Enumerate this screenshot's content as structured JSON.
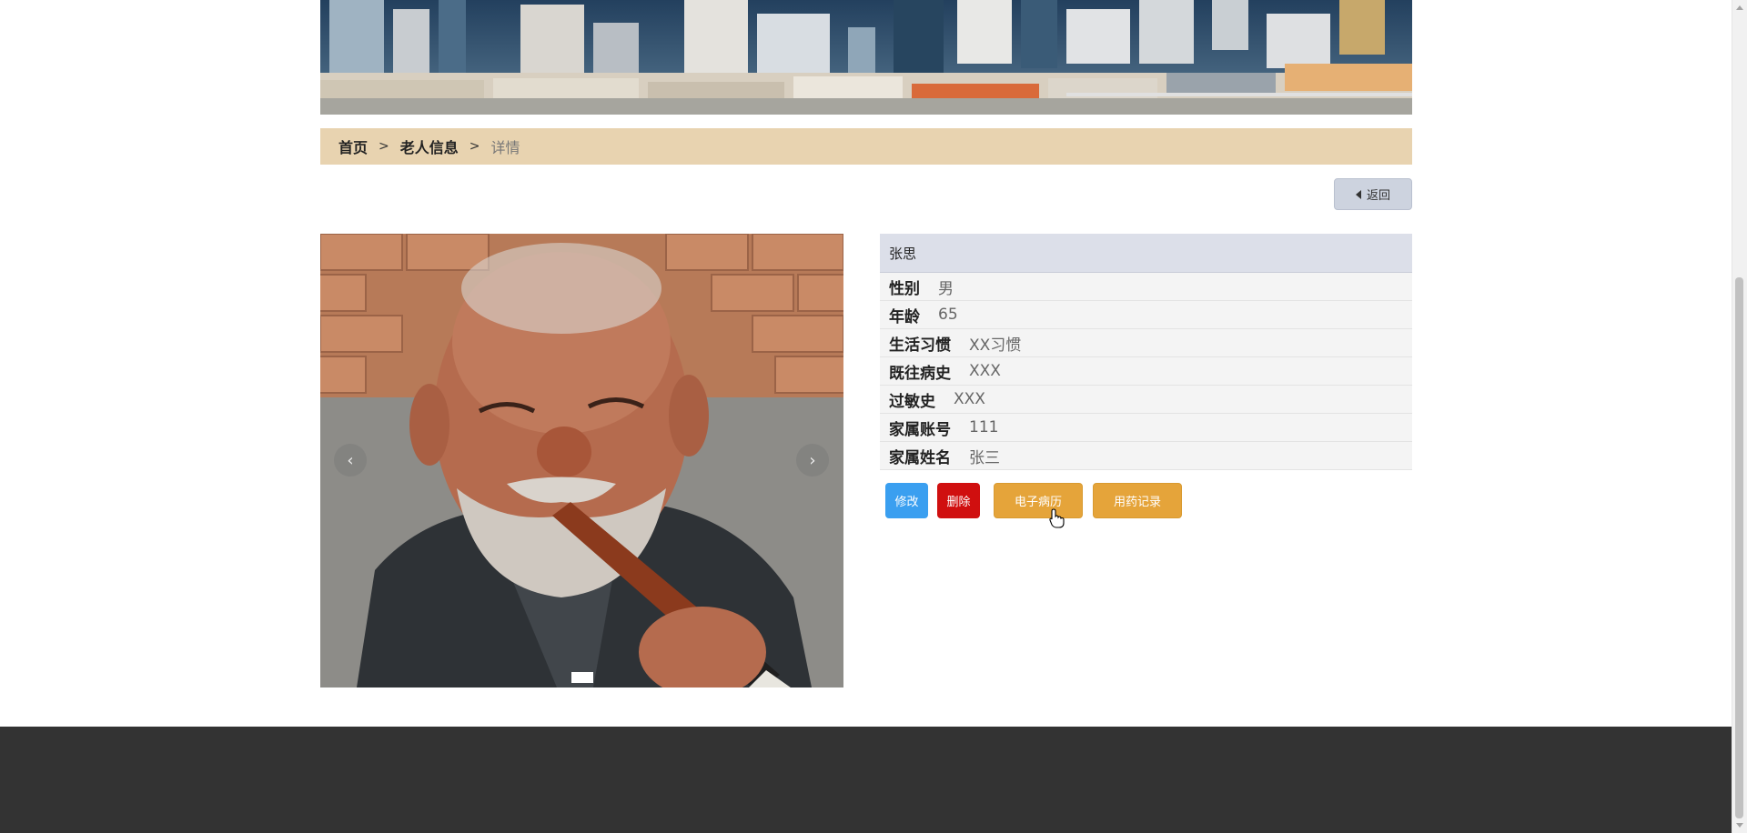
{
  "breadcrumb": {
    "home": "首页",
    "sep1": ">",
    "section": "老人信息",
    "sep2": ">",
    "current": "详情"
  },
  "back_button": {
    "label": "返回",
    "icon": "caret-left-icon"
  },
  "carousel": {
    "prev_icon": "‹",
    "next_icon": "›",
    "slide_count": 1,
    "active_slide": 1
  },
  "profile": {
    "name": "张思",
    "fields": [
      {
        "label": "性别",
        "value": "男"
      },
      {
        "label": "年龄",
        "value": "65"
      },
      {
        "label": "生活习惯",
        "value": "XX习惯"
      },
      {
        "label": "既往病史",
        "value": "XXX"
      },
      {
        "label": "过敏史",
        "value": "XXX"
      },
      {
        "label": "家属账号",
        "value": "111"
      },
      {
        "label": "家属姓名",
        "value": "张三"
      }
    ]
  },
  "actions": {
    "edit": "修改",
    "delete": "删除",
    "emr": "电子病历",
    "medication": "用药记录"
  },
  "colors": {
    "breadcrumb_bg": "#e8d3b0",
    "edit": "#3a9ff0",
    "delete": "#d00f0f",
    "warning": "#e5a43a",
    "footer": "#333333"
  }
}
